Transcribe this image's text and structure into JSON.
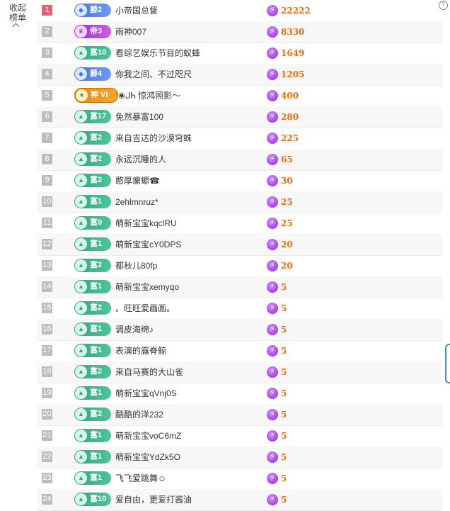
{
  "sidebar": {
    "line1": "收起",
    "line2": "榜单",
    "chevron_icon": "chevron-up-icon"
  },
  "help_icon": "question-icon",
  "colors": {
    "rank_top": "#f05b72",
    "rank_default": "#bdbdbd",
    "score": "#f26a10",
    "fu_badge": "#2da77f",
    "jue_badge": "#3e74e6",
    "di_badge": "#9b2fd6",
    "shen_badge": "#e8840a"
  },
  "rows": [
    {
      "rank": "1",
      "badge_type": "jue",
      "badge": "爵2",
      "name": "小帝国总督",
      "score": "22222"
    },
    {
      "rank": "2",
      "badge_type": "di",
      "badge": "帝3",
      "name": "雨神007",
      "score": "8330"
    },
    {
      "rank": "3",
      "badge_type": "fu",
      "badge": "富10",
      "name": "看综艺娱乐节目的蚁蜂",
      "score": "1649"
    },
    {
      "rank": "4",
      "badge_type": "jue",
      "badge": "爵4",
      "name": "你我之间、不过咫尺",
      "score": "1205"
    },
    {
      "rank": "5",
      "badge_type": "shen",
      "badge": "神 VI",
      "name": "ʿ❀ᒍᏂ 惊鸿照影～",
      "score": "400"
    },
    {
      "rank": "6",
      "badge_type": "fu",
      "badge": "富17",
      "name": "免然暴富100",
      "score": "280"
    },
    {
      "rank": "7",
      "badge_type": "fu",
      "badge": "富2",
      "name": "来自吉达的沙漠穹蛛",
      "score": "225"
    },
    {
      "rank": "8",
      "badge_type": "fu",
      "badge": "富2",
      "name": "永远沉睡的人",
      "score": "65"
    },
    {
      "rank": "9",
      "badge_type": "fu",
      "badge": "富2",
      "name": "憨厚瘰螈☎",
      "score": "30"
    },
    {
      "rank": "10",
      "badge_type": "fu",
      "badge": "富1",
      "name": "2ehlmnruz*",
      "score": "25"
    },
    {
      "rank": "11",
      "badge_type": "fu",
      "badge": "富9",
      "name": "萌新宝宝kqclRU",
      "score": "25"
    },
    {
      "rank": "12",
      "badge_type": "fu",
      "badge": "富1",
      "name": "萌新宝宝cY0DPS",
      "score": "20"
    },
    {
      "rank": "13",
      "badge_type": "fu",
      "badge": "富2",
      "name": "都秋儿80fp",
      "score": "20"
    },
    {
      "rank": "14",
      "badge_type": "fu",
      "badge": "富1",
      "name": "萌新宝宝xemyqo",
      "score": "5"
    },
    {
      "rank": "15",
      "badge_type": "fu",
      "badge": "富2",
      "name": "。旺旺爱画画。",
      "score": "5"
    },
    {
      "rank": "16",
      "badge_type": "fu",
      "badge": "富1",
      "name": "调皮海绵♪",
      "score": "5"
    },
    {
      "rank": "17",
      "badge_type": "fu",
      "badge": "富1",
      "name": "表演的露脊鲸",
      "score": "5"
    },
    {
      "rank": "18",
      "badge_type": "fu",
      "badge": "富2",
      "name": "来自马赛的大山雀",
      "score": "5"
    },
    {
      "rank": "19",
      "badge_type": "fu",
      "badge": "富1",
      "name": "萌新宝宝qVnj0S",
      "score": "5"
    },
    {
      "rank": "20",
      "badge_type": "fu",
      "badge": "富2",
      "name": "酷酷的洋232",
      "score": "5"
    },
    {
      "rank": "21",
      "badge_type": "fu",
      "badge": "富1",
      "name": "萌新宝宝voC6mZ",
      "score": "5"
    },
    {
      "rank": "22",
      "badge_type": "fu",
      "badge": "富1",
      "name": "萌新宝宝YdZk5O",
      "score": "5"
    },
    {
      "rank": "23",
      "badge_type": "fu",
      "badge": "富1",
      "name": "飞飞爱跳舞☺",
      "score": "5"
    },
    {
      "rank": "24",
      "badge_type": "fu",
      "badge": "富10",
      "name": "爱自由，更爱打酱油",
      "score": "5"
    }
  ]
}
